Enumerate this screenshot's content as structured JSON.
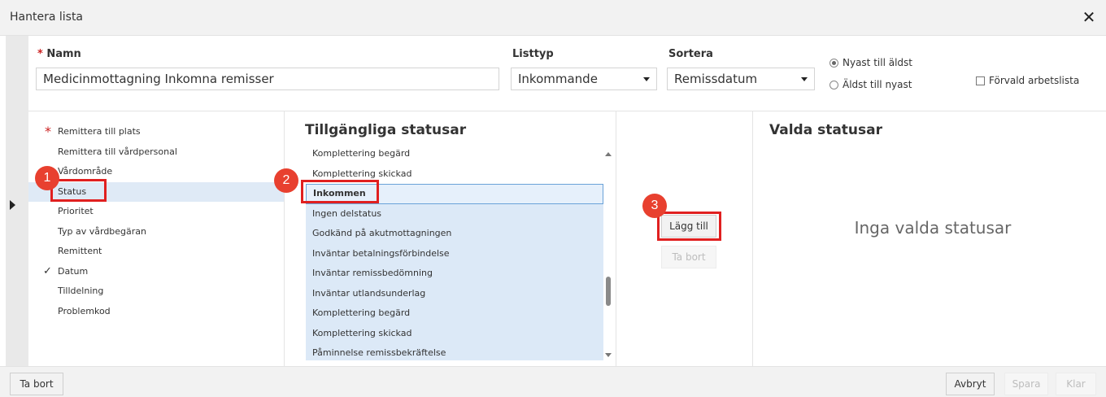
{
  "dialog": {
    "title": "Hantera lista",
    "close_icon": "close-icon"
  },
  "form": {
    "name_label": "Namn",
    "name_value": "Medicinmottagning Inkomna remisser",
    "listtyp_label": "Listtyp",
    "listtyp_value": "Inkommande",
    "sortera_label": "Sortera",
    "sortera_value": "Remissdatum",
    "order_options": [
      {
        "label": "Nyast till äldst",
        "checked": true
      },
      {
        "label": "Äldst till nyast",
        "checked": false
      }
    ],
    "default_worklist_label": "Förvald arbetslista",
    "default_worklist_checked": false
  },
  "fields": [
    {
      "label": "Remittera till plats",
      "required": true,
      "checked": false,
      "selected": false
    },
    {
      "label": "Remittera till vårdpersonal",
      "required": false,
      "checked": false,
      "selected": false
    },
    {
      "label": "Vårdområde",
      "required": false,
      "checked": false,
      "selected": false
    },
    {
      "label": "Status",
      "required": false,
      "checked": false,
      "selected": true
    },
    {
      "label": "Prioritet",
      "required": false,
      "checked": false,
      "selected": false
    },
    {
      "label": "Typ av vårdbegäran",
      "required": false,
      "checked": false,
      "selected": false
    },
    {
      "label": "Remittent",
      "required": false,
      "checked": false,
      "selected": false
    },
    {
      "label": "Datum",
      "required": false,
      "checked": true,
      "selected": false
    },
    {
      "label": "Tilldelning",
      "required": false,
      "checked": false,
      "selected": false
    },
    {
      "label": "Problemkod",
      "required": false,
      "checked": false,
      "selected": false
    }
  ],
  "available": {
    "heading": "Tillgängliga statusar",
    "items": [
      {
        "label": "Komplettering begärd",
        "state": ""
      },
      {
        "label": "Komplettering skickad",
        "state": ""
      },
      {
        "label": "Inkommen",
        "state": "current"
      },
      {
        "label": "Ingen delstatus",
        "state": "hl"
      },
      {
        "label": "Godkänd på akutmottagningen",
        "state": "hl"
      },
      {
        "label": "Inväntar betalningsförbindelse",
        "state": "hl"
      },
      {
        "label": "Inväntar remissbedömning",
        "state": "hl"
      },
      {
        "label": "Inväntar utlandsunderlag",
        "state": "hl"
      },
      {
        "label": "Komplettering begärd",
        "state": "hl"
      },
      {
        "label": "Komplettering skickad",
        "state": "hl"
      },
      {
        "label": "Påminnelse remissbekräftelse",
        "state": "hl"
      }
    ]
  },
  "actions": {
    "add_label": "Lägg till",
    "remove_label": "Ta bort"
  },
  "selected": {
    "heading": "Valda statusar",
    "empty_text": "Inga valda statusar"
  },
  "annotations": [
    "1",
    "2",
    "3"
  ],
  "footer": {
    "delete_label": "Ta bort",
    "cancel_label": "Avbryt",
    "save_label": "Spara",
    "done_label": "Klar"
  },
  "colors": {
    "selection": "#dfeaf6",
    "annotation_red": "#e02020",
    "badge": "#e8402f"
  }
}
